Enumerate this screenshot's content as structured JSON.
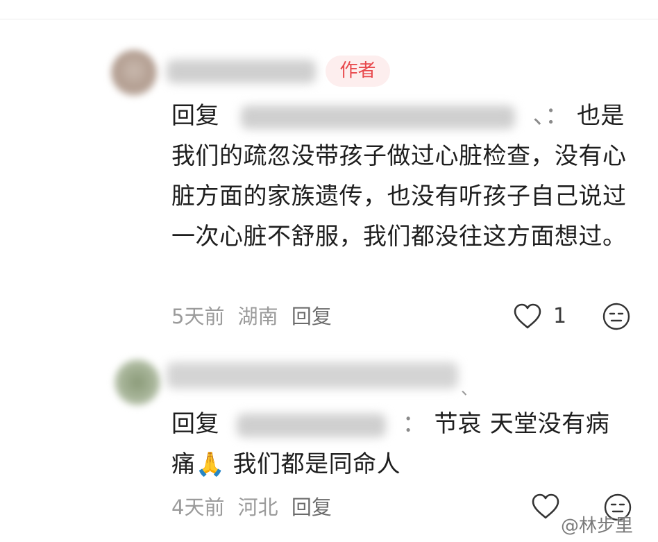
{
  "comments": [
    {
      "badge": "作者",
      "reply_prefix": "回复",
      "mention_suffix": "、：",
      "text": "也是我们的疏忽没带孩子做过心脏检查，没有心脏方面的家族遗传，也没有听孩子自己说过一次心脏不舒服，我们都没往这方面想过。",
      "time": "5天前",
      "location": "湖南",
      "reply_action": "回复",
      "like_count": "1",
      "like_icon": "heart-outline-icon",
      "emoji_icon": "neutral-face-icon"
    },
    {
      "name_suffix": "、",
      "reply_prefix": "回复",
      "mention_suffix": "：",
      "text": "节哀 天堂没有病痛🙏 我们都是同命人",
      "time": "4天前",
      "location": "河北",
      "reply_action": "回复",
      "like_icon": "heart-outline-icon",
      "emoji_icon": "neutral-face-icon"
    }
  ],
  "watermark": "@林步里",
  "colors": {
    "badge_text": "#e8484c",
    "badge_bg": "#fdeeee",
    "meta": "#9b9b9b"
  }
}
